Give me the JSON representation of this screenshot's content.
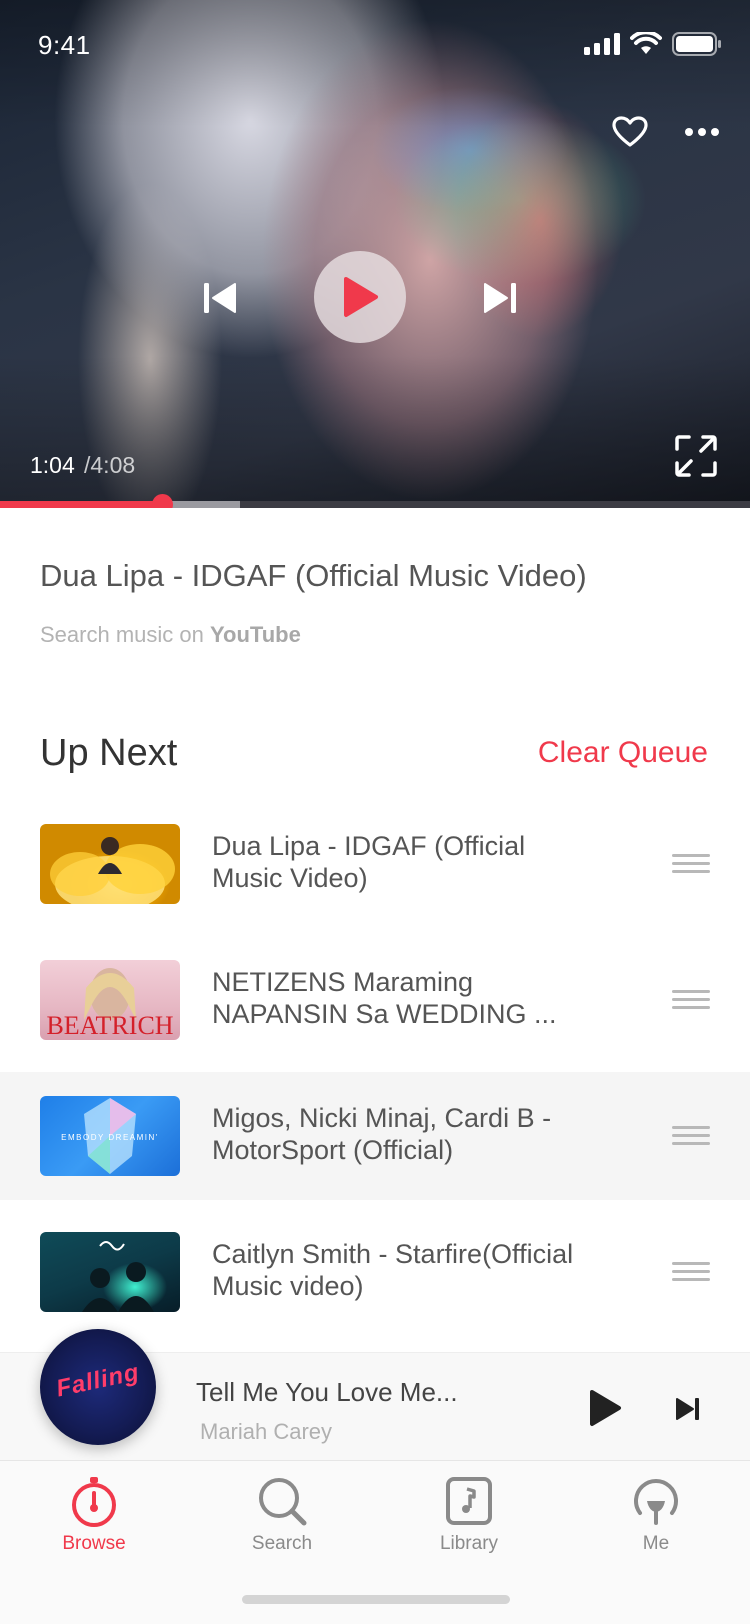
{
  "status_bar": {
    "time": "9:41"
  },
  "player": {
    "current_time": "1:04",
    "total_time": "/4:08",
    "progress_fraction": 0.216,
    "buffered_fraction": 0.32
  },
  "now_playing": {
    "title": "Dua Lipa - IDGAF (Official Music Video)",
    "search_prefix": "Search music on ",
    "search_source": "YouTube"
  },
  "queue": {
    "heading": "Up Next",
    "clear_label": "Clear Queue",
    "items": [
      {
        "title": "Dua Lipa - IDGAF (Official Music Video)"
      },
      {
        "title": "NETIZENS Maraming NAPANSIN Sa WEDDING ...",
        "thumb_text": "BEATRICH"
      },
      {
        "title": "Migos, Nicki Minaj, Cardi B - MotorSport (Official)",
        "thumb_text": "EMBODY DREAMIN'"
      },
      {
        "title": "Caitlyn Smith - Starfire(Official Music video)"
      }
    ]
  },
  "mini_player": {
    "title": "Tell Me You Love Me...",
    "artist": "Mariah Carey",
    "art_text": "Falling"
  },
  "tabs": [
    {
      "label": "Browse",
      "active": true
    },
    {
      "label": "Search",
      "active": false
    },
    {
      "label": "Library",
      "active": false
    },
    {
      "label": "Me",
      "active": false
    }
  ],
  "colors": {
    "accent": "#f0394b"
  }
}
